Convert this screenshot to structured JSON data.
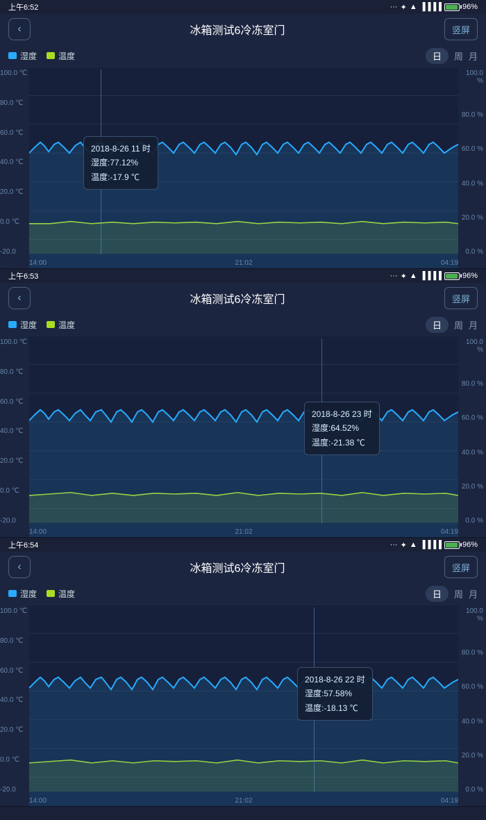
{
  "panels": [
    {
      "id": "panel1",
      "statusTime": "上午6:52",
      "title": "冰箱测试6冷冻室门",
      "backLabel": "‹",
      "landscapeLabel": "竖屏",
      "legend": {
        "humidity": "湿度",
        "temperature": "温度"
      },
      "tabs": {
        "day": "日",
        "week": "周",
        "month": "月"
      },
      "yLeft": [
        "100.0 ℃",
        "80.0 ℃",
        "60.0 ℃",
        "40.0 ℃",
        "20.0 ℃",
        "0.0 ℃",
        "-20.0"
      ],
      "yRight": [
        "100.0 %",
        "80.0 %",
        "60.0 %",
        "40.0 %",
        "20.0 %",
        "0.0 %"
      ],
      "xLabels": [
        "14:00",
        "21:02",
        "04:19"
      ],
      "tooltip": {
        "position": "left",
        "line1": "2018-8-26 11 时",
        "line2": "湿度:77.12%",
        "line3": "温度:-17.9 ℃",
        "vlineLeft": "145px"
      }
    },
    {
      "id": "panel2",
      "statusTime": "上午6:53",
      "title": "冰箱测试6冷冻室门",
      "backLabel": "‹",
      "landscapeLabel": "竖屏",
      "legend": {
        "humidity": "湿度",
        "temperature": "温度"
      },
      "tabs": {
        "day": "日",
        "week": "周",
        "month": "月"
      },
      "yLeft": [
        "100.0 ℃",
        "80.0 ℃",
        "60.0 ℃",
        "40.0 ℃",
        "20.0 ℃",
        "0.0 ℃",
        "-20.0"
      ],
      "yRight": [
        "100.0 %",
        "80.0 %",
        "60.0 %",
        "40.0 %",
        "20.0 %",
        "0.0 %"
      ],
      "xLabels": [
        "14:00",
        "21:02",
        "04:19"
      ],
      "tooltip": {
        "position": "right",
        "line1": "2018-8-26 23 时",
        "line2": "湿度:64.52%",
        "line3": "温度:-21.38 ℃",
        "vlineLeft": "463px"
      }
    },
    {
      "id": "panel3",
      "statusTime": "上午6:54",
      "title": "冰箱测试6冷冻室门",
      "backLabel": "‹",
      "landscapeLabel": "竖屏",
      "legend": {
        "humidity": "湿度",
        "temperature": "温度"
      },
      "tabs": {
        "day": "日",
        "week": "周",
        "month": "月"
      },
      "yLeft": [
        "100.0 ℃",
        "80.0 ℃",
        "60.0 ℃",
        "40.0 ℃",
        "20.0 ℃",
        "0.0 ℃",
        "-20.0"
      ],
      "yRight": [
        "100.0 %",
        "80.0 %",
        "60.0 %",
        "40.0 %",
        "20.0 %",
        "0.0 %"
      ],
      "xLabels": [
        "14:00",
        "21:02",
        "04:19"
      ],
      "tooltip": {
        "position": "right2",
        "line1": "2018-8-26 22 时",
        "line2": "湿度:57.58%",
        "line3": "温度:-18.13 ℃",
        "vlineLeft": "452px"
      }
    }
  ],
  "colors": {
    "humidity": "#29aaff",
    "temperature": "#aadd22",
    "background": "#1c2540",
    "chartBg": "#16203a"
  }
}
